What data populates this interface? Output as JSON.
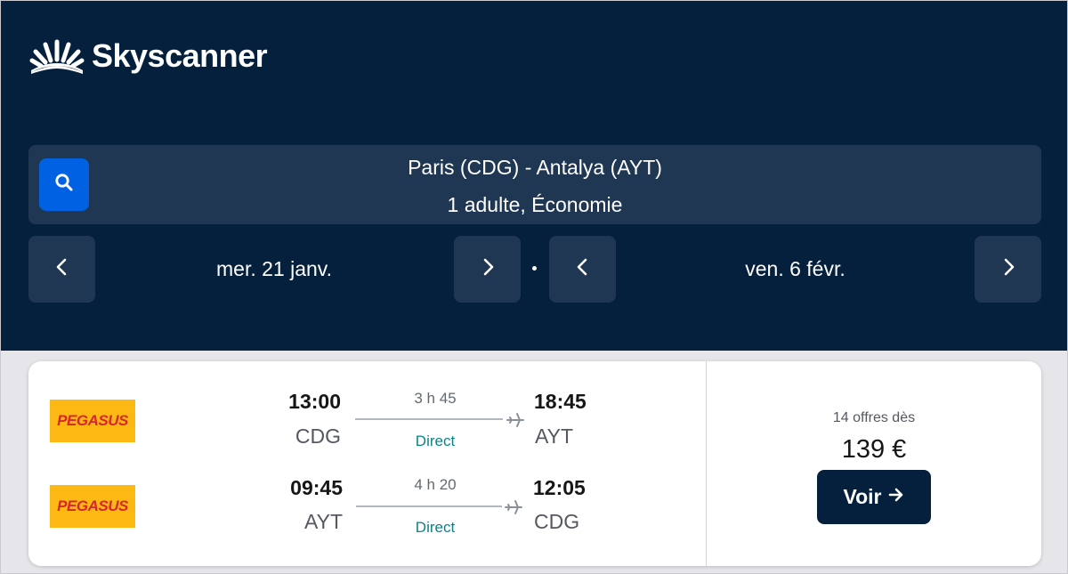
{
  "brand": {
    "name": "Skyscanner"
  },
  "search": {
    "route": "Paris (CDG) - Antalya (AYT)",
    "passengers": "1 adulte, Économie"
  },
  "dates": {
    "outbound": "mer. 21 janv.",
    "return": "ven. 6 févr."
  },
  "result": {
    "legs": [
      {
        "airline": "PEGASUS",
        "depart_time": "13:00",
        "depart_airport": "CDG",
        "duration": "3 h 45",
        "stops": "Direct",
        "arrive_time": "18:45",
        "arrive_airport": "AYT"
      },
      {
        "airline": "PEGASUS",
        "depart_time": "09:45",
        "depart_airport": "AYT",
        "duration": "4 h 20",
        "stops": "Direct",
        "arrive_time": "12:05",
        "arrive_airport": "CDG"
      }
    ],
    "offers_text": "14 offres dès",
    "price": "139 €",
    "select_label": "Voir"
  },
  "colors": {
    "header_bg": "#05203c",
    "panel_bg": "#1f3752",
    "search_button": "#0062e3",
    "direct_text": "#0c838a",
    "pegasus_yellow": "#fdb913",
    "pegasus_red": "#d8262f"
  },
  "icons": {
    "logo": "skyscanner-sunburst-icon",
    "search": "search-icon",
    "prev": "chevron-left-icon",
    "next": "chevron-right-icon",
    "plane": "plane-icon",
    "arrow": "arrow-right-icon"
  }
}
